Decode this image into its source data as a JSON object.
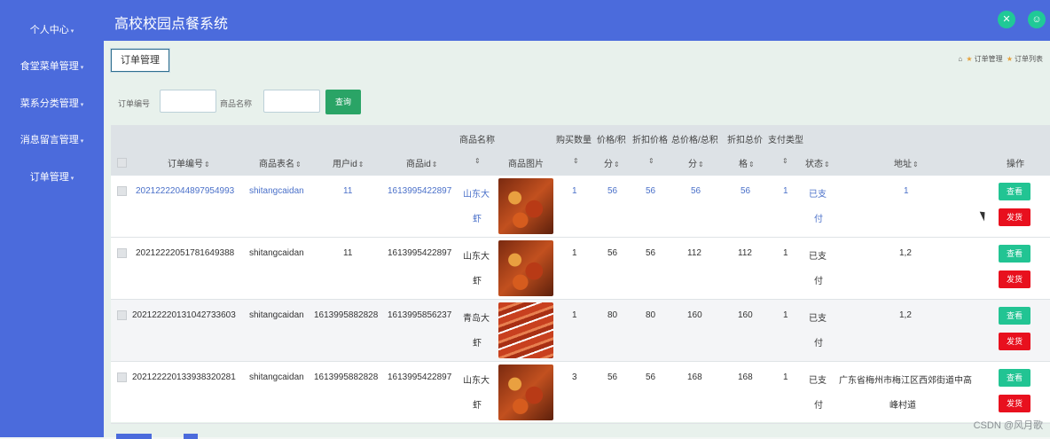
{
  "app": {
    "title": "高校校园点餐系统"
  },
  "sidebar": {
    "items": [
      {
        "label": "个人中心"
      },
      {
        "label": "食堂菜单管理"
      },
      {
        "label": "菜系分类管理"
      },
      {
        "label": "消息留言管理"
      },
      {
        "label": "订单管理"
      }
    ]
  },
  "header": {
    "icons": [
      "fullscreen-icon",
      "user-icon"
    ]
  },
  "page": {
    "tab_label": "订单管理"
  },
  "breadcrumb": {
    "items": [
      "订单管理",
      "订单列表"
    ]
  },
  "filters": {
    "order_no_label": "订单编号",
    "order_no_value": "",
    "product_name_label": "商品名称",
    "product_name_value": "",
    "search_label": "查询"
  },
  "table": {
    "headers": {
      "order_no": "订单编号",
      "table_name": "商品表名",
      "user_id": "用户id",
      "product_id": "商品id",
      "product_name": "商品名称",
      "image": "商品图片",
      "qty": "购买数量",
      "price_a": "价格/积",
      "price_b": "分",
      "discount_a": "折扣价格",
      "total_a": "总价格/总积",
      "total_b": "分",
      "disc_total_a": "折扣总价",
      "disc_total_b": "格",
      "pay_type": "支付类型",
      "status": "状态",
      "address": "地址",
      "actions": "操作"
    },
    "rows": [
      {
        "order_no": "20212222044897954993",
        "table_name": "shitangcaidan",
        "user_id": "11",
        "product_id": "1613995422897",
        "name1": "山东大",
        "name2": "虾",
        "qty": "1",
        "price": "56",
        "discount": "56",
        "total": "56",
        "disc_total": "56",
        "pay_type": "1",
        "status1": "已支",
        "status2": "付",
        "addr1": "1",
        "addr2": "",
        "view": "查看",
        "ship": "发货"
      },
      {
        "order_no": "20212222051781649388",
        "table_name": "shitangcaidan",
        "user_id": "11",
        "product_id": "1613995422897",
        "name1": "山东大",
        "name2": "虾",
        "qty": "1",
        "price": "56",
        "discount": "56",
        "total": "112",
        "disc_total": "112",
        "pay_type": "1",
        "status1": "已支",
        "status2": "付",
        "addr1": "1,2",
        "addr2": "",
        "view": "查看",
        "ship": "发货"
      },
      {
        "order_no": "20212222013104273360​3",
        "table_name": "shitangcaidan",
        "user_id": "1613995882828",
        "product_id": "1613995856237",
        "name1": "青岛大",
        "name2": "虾",
        "qty": "1",
        "price": "80",
        "discount": "80",
        "total": "160",
        "disc_total": "160",
        "pay_type": "1",
        "status1": "已支",
        "status2": "付",
        "addr1": "1,2",
        "addr2": "",
        "view": "查看",
        "ship": "发货"
      },
      {
        "order_no": "20212222013393832028​1",
        "table_name": "shitangcaidan",
        "user_id": "1613995882828",
        "product_id": "1613995422897",
        "name1": "山东大",
        "name2": "虾",
        "qty": "3",
        "price": "56",
        "discount": "56",
        "total": "168",
        "disc_total": "168",
        "pay_type": "1",
        "status1": "已支",
        "status2": "付",
        "addr1": "广东省梅州市梅江区西郊街道中高",
        "addr2": "峰村道",
        "view": "查看",
        "ship": "发货"
      }
    ]
  },
  "watermark": "CSDN @风月歌"
}
